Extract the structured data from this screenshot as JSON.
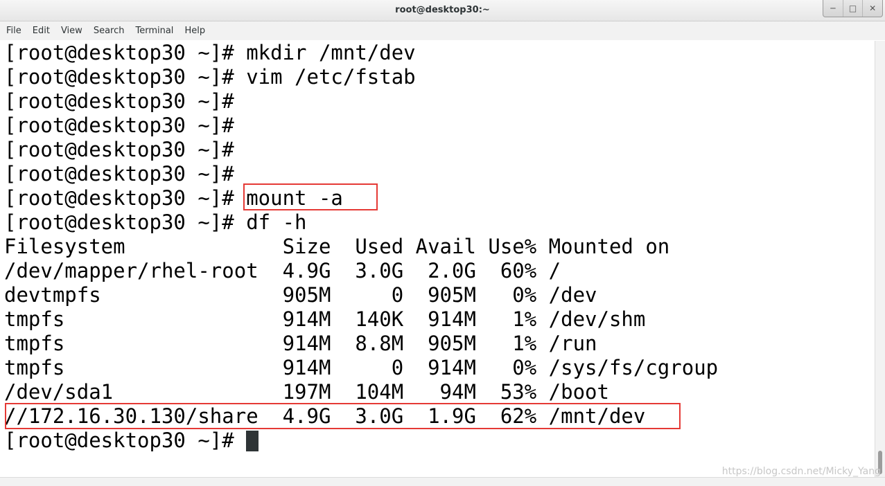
{
  "window": {
    "title": "root@desktop30:~",
    "controls": {
      "minimize": "─",
      "maximize": "□",
      "close": "✕"
    }
  },
  "menubar": {
    "items": [
      "File",
      "Edit",
      "View",
      "Search",
      "Terminal",
      "Help"
    ]
  },
  "terminal": {
    "lines": [
      "[root@desktop30 ~]# mkdir /mnt/dev",
      "[root@desktop30 ~]# vim /etc/fstab",
      "[root@desktop30 ~]#",
      "[root@desktop30 ~]#",
      "[root@desktop30 ~]#",
      "[root@desktop30 ~]#",
      "[root@desktop30 ~]# mount -a",
      "[root@desktop30 ~]# df -h",
      "Filesystem             Size  Used Avail Use% Mounted on",
      "/dev/mapper/rhel-root  4.9G  3.0G  2.0G  60% /",
      "devtmpfs               905M     0  905M   0% /dev",
      "tmpfs                  914M  140K  914M   1% /dev/shm",
      "tmpfs                  914M  8.8M  905M   1% /run",
      "tmpfs                  914M     0  914M   0% /sys/fs/cgroup",
      "/dev/sda1              197M  104M   94M  53% /boot",
      "//172.16.30.130/share  4.9G  3.0G  1.9G  62% /mnt/dev"
    ],
    "prompt": "[root@desktop30 ~]# "
  },
  "highlight_color": "#e53935",
  "watermark": "https://blog.csdn.net/Micky_Yang"
}
